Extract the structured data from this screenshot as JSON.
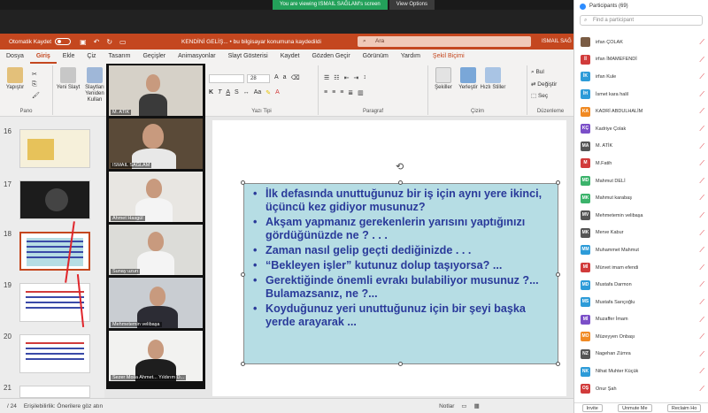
{
  "zoom": {
    "share_message": "You are viewing ISMAIL SAĞLAM's screen",
    "view_options": "View Options"
  },
  "ppt": {
    "autosave_label": "Otomatik Kaydet",
    "doc_title": "KENDİNİ GELİŞ...  •  bu bilgisayar konumuna kaydedildi",
    "search_placeholder": "Ara",
    "user_name": "ISMAIL SAĞ",
    "tabs": [
      "Dosya",
      "Giriş",
      "Ekle",
      "Çiz",
      "Tasarım",
      "Geçişler",
      "Animasyonlar",
      "Slayt Gösterisi",
      "Kaydet",
      "Gözden Geçir",
      "Görünüm",
      "Yardım",
      "Şekil Biçimi"
    ],
    "active_tab": "Giriş",
    "ribbon": {
      "paste": "Yapıştır",
      "clipboard_group": "Pano",
      "new_slide": "Yeni Slayt",
      "reuse_slides": "Slaytları Yeniden Kullan",
      "font_name": "",
      "font_size": "28",
      "font_group": "Yazı Tipi",
      "paragraph_group": "Paragraf",
      "shapes": "Şekiller",
      "arrange": "Yerleştir",
      "quick_styles": "Hızlı Stiller",
      "drawing_group": "Çizim",
      "find": "Bul",
      "replace": "Değiştir",
      "select": "Seç",
      "editing_group": "Düzenleme"
    },
    "thumbnails": [
      {
        "num": "16"
      },
      {
        "num": "17"
      },
      {
        "num": "18"
      },
      {
        "num": "19"
      },
      {
        "num": "20"
      },
      {
        "num": "21"
      }
    ],
    "slide_bullets": [
      "İlk defasında unuttuğunuz bir iş için aynı yere ikinci, üçüncü kez gidiyor musunuz?",
      "Akşam yapmanız gerekenlerin yarısını yaptığınızı gördüğünüzde  ne ? . . .",
      "Zaman nasıl gelip geçti dediğinizde . . .",
      "“Bekleyen işler” kutunuz dolup taşıyorsa? ...",
      "Gerektiğinde önemli evrakı bulabiliyor musunuz ?... Bulamazsanız, ne ?...",
      "Koyduğunuz yeri unuttuğunuz için bir şeyi başka yerde arayarak ..."
    ],
    "status": {
      "slide_counter": "/ 24",
      "accessibility": "Erişilebilirlik: Önerilere göz atın",
      "notes": "Notlar"
    }
  },
  "video_tiles": [
    {
      "name": "M. ATİK",
      "bg": "#d6d1c8"
    },
    {
      "name": "ISMAIL SAĞLAM",
      "bg": "#5a4a38"
    },
    {
      "name": "Ahmet Hasgül",
      "bg": "#e8e6e2"
    },
    {
      "name": "Sunay uzun",
      "bg": "#dcdcd8"
    },
    {
      "name": "Mehmetemin velibaşa",
      "bg": "#c9cdd2"
    },
    {
      "name": "Sezer Molla Ahmet... Yıldırım D...",
      "bg": "#f2f2f0"
    }
  ],
  "participants_panel": {
    "title": "Participants (69)",
    "search_placeholder": "Find a participant",
    "invite": "Invite",
    "unmute_me": "Unmute Me",
    "reclaim_host": "Reclaim Ho",
    "list": [
      {
        "initials": "",
        "name": "irfan ÇOLAK",
        "color": "#7a5c44"
      },
      {
        "initials": "İİ",
        "name": "irfan İMAMEFENDİ",
        "color": "#d13b3b"
      },
      {
        "initials": "İK",
        "name": "irfan Kule",
        "color": "#2d9bd8"
      },
      {
        "initials": "İH",
        "name": "İsmet kara halil",
        "color": "#2d9bd8"
      },
      {
        "initials": "KA",
        "name": "KADRİ ABDULHALİM",
        "color": "#f08a24"
      },
      {
        "initials": "KÇ",
        "name": "Kadriye Çolak",
        "color": "#7b4fc8"
      },
      {
        "initials": "MA",
        "name": "M. ATİK",
        "color": "#555555"
      },
      {
        "initials": "M",
        "name": "M.Fatih",
        "color": "#d13b3b"
      },
      {
        "initials": "MD",
        "name": "Mahmut DELİ",
        "color": "#3bb36b"
      },
      {
        "initials": "MK",
        "name": "Mahmut karabaş",
        "color": "#3bb36b"
      },
      {
        "initials": "MV",
        "name": "Mehmetemin velibaşa",
        "color": "#555555"
      },
      {
        "initials": "MK",
        "name": "Merve Kabur",
        "color": "#555555"
      },
      {
        "initials": "MM",
        "name": "Muhammet Mahmut",
        "color": "#2d9bd8"
      },
      {
        "initials": "Mİ",
        "name": "Mürvet imam efendi",
        "color": "#d13b3b"
      },
      {
        "initials": "MD",
        "name": "Mustafa Darmon",
        "color": "#2d9bd8"
      },
      {
        "initials": "MS",
        "name": "Mustafa Sarıçoğlu",
        "color": "#2d9bd8"
      },
      {
        "initials": "Mİ",
        "name": "Muzaffer İmam",
        "color": "#7b4fc8"
      },
      {
        "initials": "MO",
        "name": "Müzeyyen Onbaşı",
        "color": "#f08a24"
      },
      {
        "initials": "NZ",
        "name": "Nagehan Zümra",
        "color": "#555555"
      },
      {
        "initials": "NK",
        "name": "Nihat Muhter Küçük",
        "color": "#2d9bd8"
      },
      {
        "initials": "OŞ",
        "name": "Onur Şah",
        "color": "#d13b3b"
      }
    ]
  }
}
